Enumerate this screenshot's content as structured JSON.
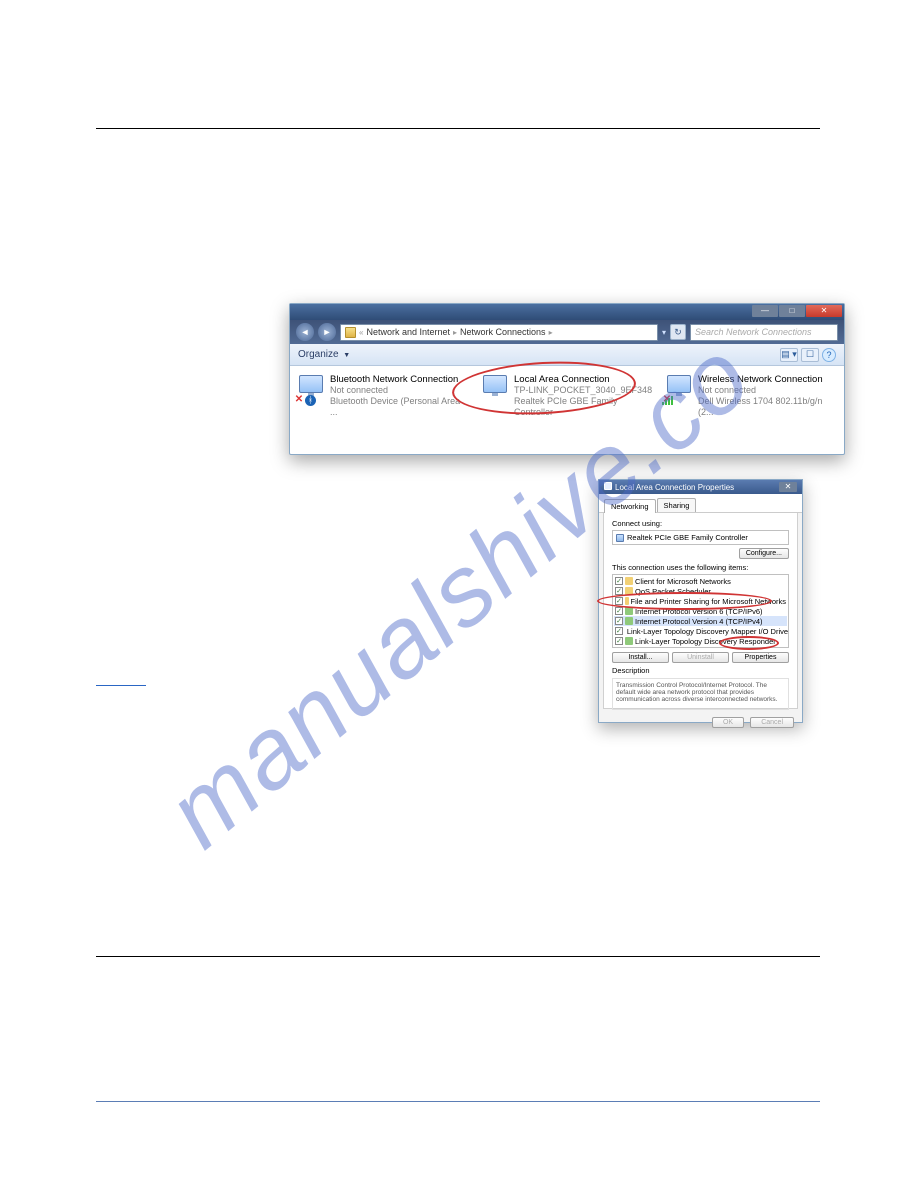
{
  "watermark": "manualshive.co",
  "ncwin": {
    "breadcrumb_root": "Network and Internet",
    "breadcrumb_current": "Network Connections",
    "search_placeholder": "Search Network Connections",
    "organize_label": "Organize",
    "connections": {
      "c0": {
        "name": "Bluetooth Network Connection",
        "status": "Not connected",
        "device": "Bluetooth Device (Personal Area ..."
      },
      "c1": {
        "name": "Local Area Connection",
        "status": "TP-LINK_POCKET_3040_9EF348",
        "device": "Realtek PCIe GBE Family Controller"
      },
      "c2": {
        "name": "Wireless Network Connection",
        "status": "Not connected",
        "device": "Dell Wireless 1704 802.11b/g/n (2..."
      }
    },
    "winbtns": {
      "min": "—",
      "max": "□",
      "close": "✕"
    }
  },
  "props": {
    "title": "Local Area Connection Properties",
    "tab_networking": "Networking",
    "tab_sharing": "Sharing",
    "connect_using_label": "Connect using:",
    "adapter": "Realtek PCIe GBE Family Controller",
    "configure_btn": "Configure...",
    "items_label": "This connection uses the following items:",
    "items": {
      "i0": "Client for Microsoft Networks",
      "i1": "QoS Packet Scheduler",
      "i2": "File and Printer Sharing for Microsoft Networks",
      "i3": "Internet Protocol Version 6 (TCP/IPv6)",
      "i4": "Internet Protocol Version 4 (TCP/IPv4)",
      "i5": "Link-Layer Topology Discovery Mapper I/O Driver",
      "i6": "Link-Layer Topology Discovery Responder"
    },
    "install_btn": "Install...",
    "uninstall_btn": "Uninstall",
    "properties_btn": "Properties",
    "desc_label": "Description",
    "desc_text": "Transmission Control Protocol/Internet Protocol. The default wide area network protocol that provides communication across diverse interconnected networks.",
    "ok_btn": "OK",
    "cancel_btn": "Cancel"
  }
}
